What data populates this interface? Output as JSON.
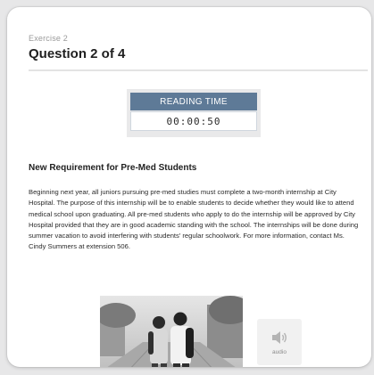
{
  "header": {
    "exercise_label": "Exercise 2",
    "question_title": "Question 2 of 4"
  },
  "timer": {
    "label": "READING TIME",
    "value": "00:00:50",
    "header_color": "#5e7a97"
  },
  "passage": {
    "heading": "New Requirement for Pre-Med Students",
    "body": "Beginning next year, all juniors pursuing pre-med studies must complete a two-month internship at City Hospital. The purpose of this internship will be to enable students to decide whether they would like to attend medical school upon graduating. All pre-med students who apply to do the internship will be approved by City Hospital provided that they are in good academic standing with the school. The internships will be done during summer vacation to avoid interfering with students' regular schoolwork. For more information, contact Ms. Cindy Summers at extension 506."
  },
  "media": {
    "photo_icon": "students-photo",
    "audio_icon": "speaker-icon",
    "audio_label": "audio"
  }
}
